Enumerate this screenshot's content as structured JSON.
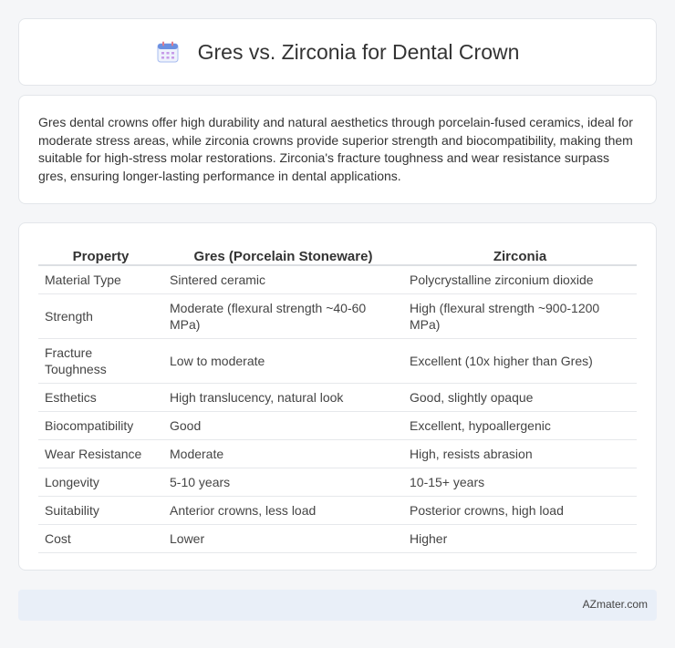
{
  "header": {
    "title": "Gres vs. Zirconia for Dental Crown",
    "icon": "calendar-icon",
    "icon_color": "#6b8fe0"
  },
  "summary": {
    "text": "Gres dental crowns offer high durability and natural aesthetics through porcelain-fused ceramics, ideal for moderate stress areas, while zirconia crowns provide superior strength and biocompatibility, making them suitable for high-stress molar restorations. Zirconia's fracture toughness and wear resistance surpass gres, ensuring longer-lasting performance in dental applications."
  },
  "table": {
    "headers": [
      "Property",
      "Gres (Porcelain Stoneware)",
      "Zirconia"
    ],
    "rows": [
      [
        "Material Type",
        "Sintered ceramic",
        "Polycrystalline zirconium dioxide"
      ],
      [
        "Strength",
        "Moderate (flexural strength ~40-60 MPa)",
        "High (flexural strength ~900-1200 MPa)"
      ],
      [
        "Fracture Toughness",
        "Low to moderate",
        "Excellent (10x higher than Gres)"
      ],
      [
        "Esthetics",
        "High translucency, natural look",
        "Good, slightly opaque"
      ],
      [
        "Biocompatibility",
        "Good",
        "Excellent, hypoallergenic"
      ],
      [
        "Wear Resistance",
        "Moderate",
        "High, resists abrasion"
      ],
      [
        "Longevity",
        "5-10 years",
        "10-15+ years"
      ],
      [
        "Suitability",
        "Anterior crowns, less load",
        "Posterior crowns, high load"
      ],
      [
        "Cost",
        "Lower",
        "Higher"
      ]
    ]
  },
  "footer": {
    "brand": "AZmater.com"
  }
}
